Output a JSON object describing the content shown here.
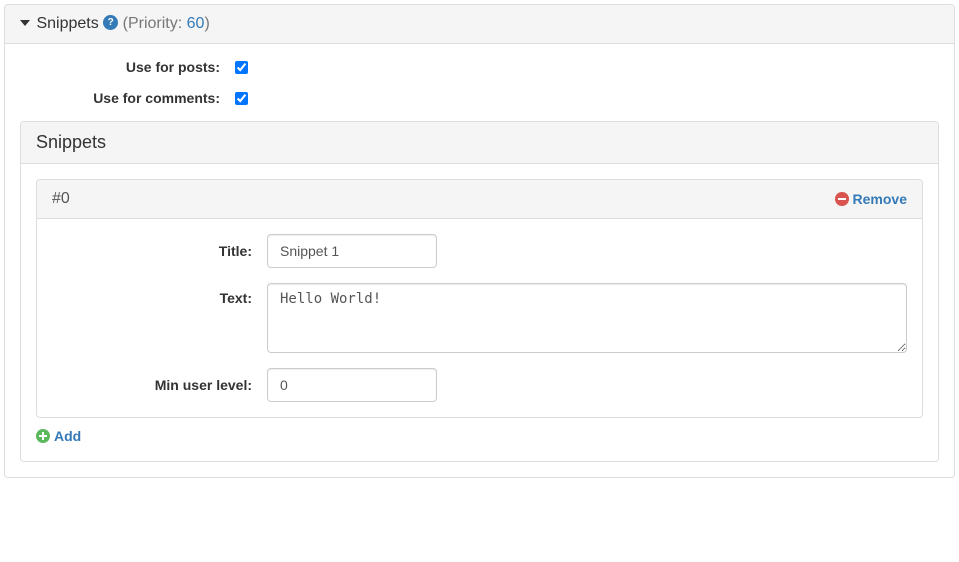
{
  "header": {
    "title": "Snippets",
    "priority_label": "Priority:",
    "priority_value": "60"
  },
  "options": {
    "use_for_posts_label": "Use for posts:",
    "use_for_posts_checked": true,
    "use_for_comments_label": "Use for comments:",
    "use_for_comments_checked": true
  },
  "snippets_panel": {
    "heading": "Snippets",
    "add_label": "Add",
    "items": [
      {
        "index_label": "#0",
        "remove_label": "Remove",
        "fields": {
          "title_label": "Title:",
          "title_value": "Snippet 1",
          "text_label": "Text:",
          "text_value": "Hello World!",
          "min_level_label": "Min user level:",
          "min_level_value": "0"
        }
      }
    ]
  }
}
